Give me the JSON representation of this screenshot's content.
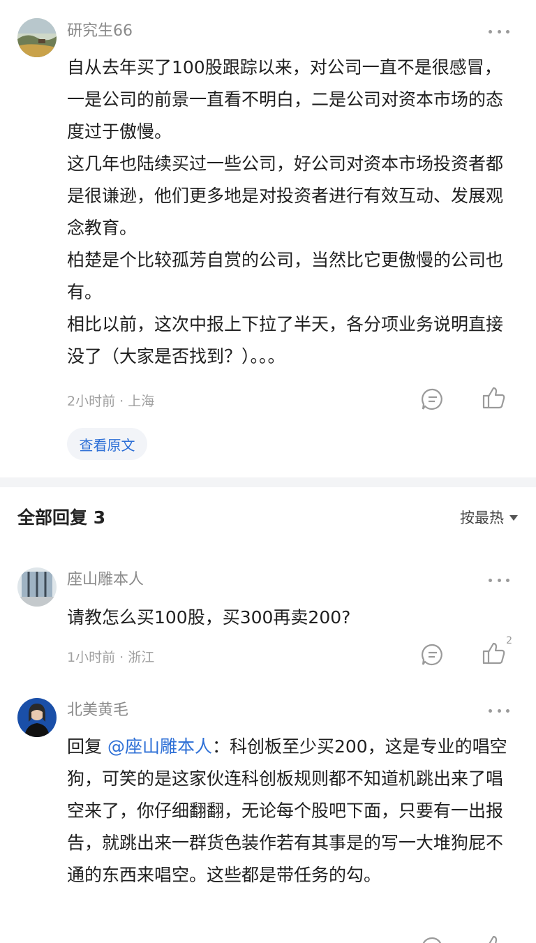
{
  "post": {
    "author": "研究生66",
    "paragraphs": [
      "自从去年买了100股跟踪以来，对公司一直不是很感冒，一是公司的前景一直看不明白，二是公司对资本市场的态度过于傲慢。",
      "这几年也陆续买过一些公司，好公司对资本市场投资者都是很谦逊，他们更多地是对投资者进行有效互动、发展观念教育。",
      "柏楚是个比较孤芳自赏的公司，当然比它更傲慢的公司也有。",
      "相比以前，这次中报上下拉了半天，各分项业务说明直接没了（大家是否找到？）。。。"
    ],
    "meta": "2小时前 · 上海",
    "view_original": "查看原文"
  },
  "replies_header": {
    "title": "全部回复 3",
    "sort_label": "按最热"
  },
  "replies": [
    {
      "author": "座山雕本人",
      "text": "请教怎么买100股，买300再卖200?",
      "meta": "1小时前 · 浙江",
      "like_count": "2"
    },
    {
      "author": "北美黄毛",
      "reply_prefix": "回复 ",
      "mention": "@座山雕本人",
      "text": "：科创板至少买200，这是专业的唱空狗，可笑的是这家伙连科创板规则都不知道机跳出来了唱空来了，你仔细翻翻，无论每个股吧下面，只要有一出报告，就跳出来一群货色装作若有其事是的写一大堆狗屁不通的东西来唱空。这些都是带任务的勾。"
    }
  ],
  "colors": {
    "link": "#2d6fd6",
    "meta": "#a0a0a0",
    "divider": "#f3f4f6"
  }
}
